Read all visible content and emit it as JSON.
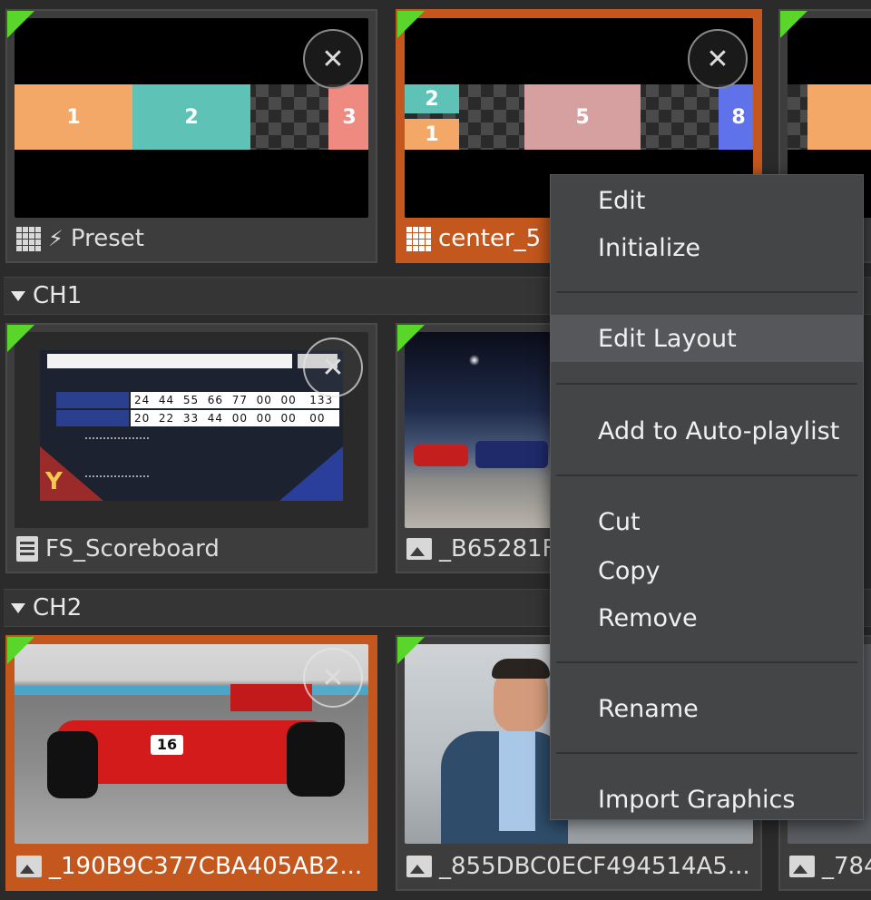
{
  "top_row": {
    "tiles": [
      {
        "caption": "Preset",
        "zones": [
          "1",
          "2",
          "3"
        ]
      },
      {
        "caption": "center_5",
        "zones": [
          "2",
          "1",
          "5",
          "8"
        ]
      }
    ]
  },
  "sections": [
    {
      "name": "CH1",
      "tiles": [
        {
          "caption": "FS_Scoreboard"
        },
        {
          "caption": "_B65281F"
        }
      ]
    },
    {
      "name": "CH2",
      "tiles": [
        {
          "caption": "_190B9C377CBA405AB2..."
        },
        {
          "caption": "_855DBC0ECF494514A5..."
        },
        {
          "caption": "_784"
        }
      ]
    }
  ],
  "scoreboard": {
    "row1": [
      "24",
      "44",
      "55",
      "66",
      "77",
      "00",
      "00",
      "133"
    ],
    "row2": [
      "20",
      "22",
      "33",
      "44",
      "00",
      "00",
      "00",
      "00"
    ]
  },
  "car": {
    "number": "16"
  },
  "context_menu": {
    "items": {
      "edit": "Edit",
      "initialize": "Initialize",
      "edit_layout": "Edit Layout",
      "add_auto_playlist": "Add to Auto-playlist",
      "cut": "Cut",
      "copy": "Copy",
      "remove": "Remove",
      "rename": "Rename",
      "import_graphics": "Import Graphics"
    }
  },
  "colors": {
    "selected_orange": "#c4571d",
    "indicator_green": "#5ad52a",
    "zone_orange": "#f3a868",
    "zone_teal": "#5fc2b6",
    "zone_salmon": "#ee8a80",
    "zone_pink": "#d6a0a0",
    "zone_blue": "#5f72e9"
  },
  "icons": {
    "layout": "grid-icon",
    "trigger": "lightning-icon",
    "image": "image-icon",
    "document": "document-icon",
    "close": "close-icon",
    "collapse": "triangle-down-icon"
  }
}
